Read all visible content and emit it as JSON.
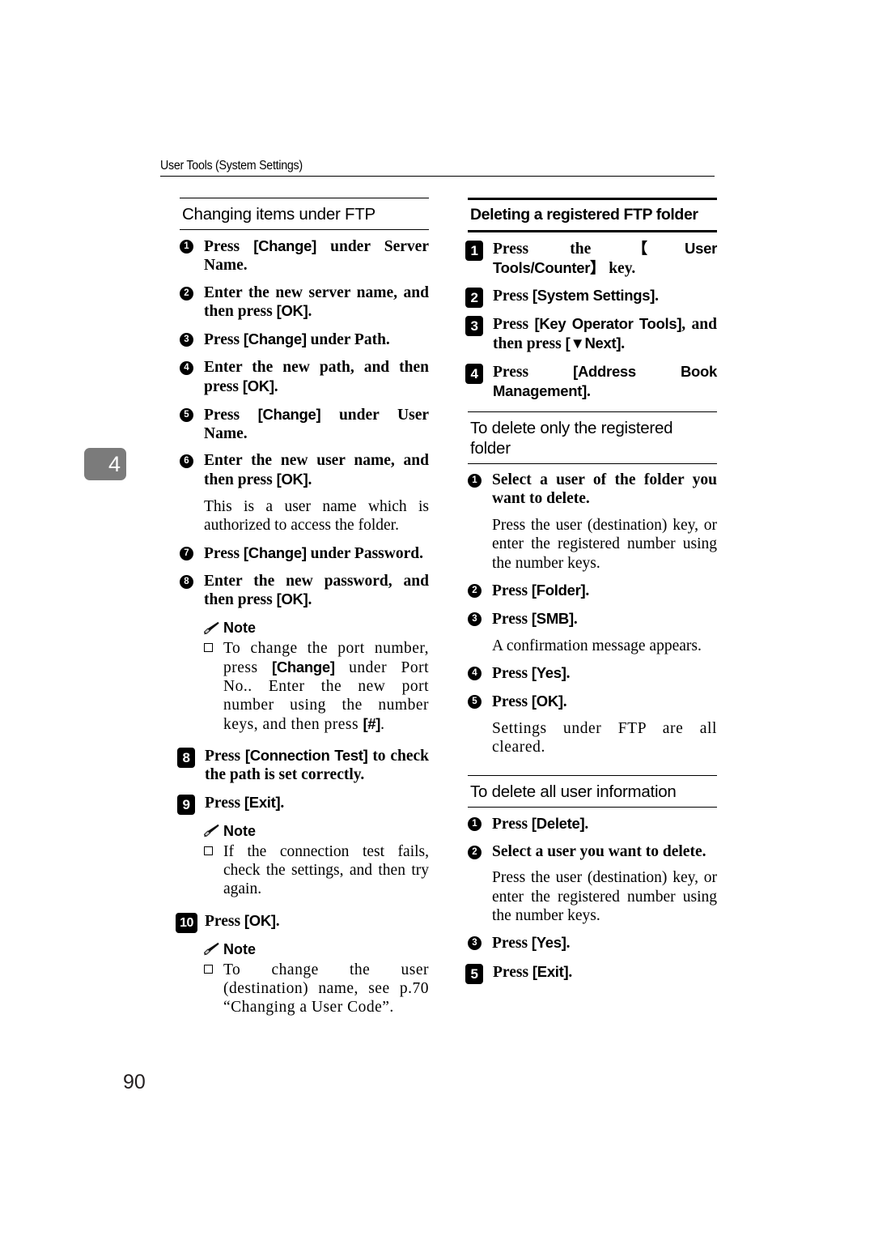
{
  "page": {
    "running_header": "User Tools (System Settings)",
    "chapter_tab": "4",
    "folio": "90"
  },
  "left_column": {
    "heading": "Changing items under FTP",
    "steps": [
      {
        "marker": "1",
        "type": "round",
        "text_parts": [
          {
            "t": "Press ",
            "style": "normal"
          },
          {
            "t": "[Change]",
            "style": "key"
          },
          {
            "t": " under Server Name.",
            "style": "normal"
          }
        ]
      },
      {
        "marker": "2",
        "type": "round",
        "text_parts": [
          {
            "t": "Enter the new server name, and then press ",
            "style": "normal"
          },
          {
            "t": "[OK]",
            "style": "key"
          },
          {
            "t": ".",
            "style": "normal"
          }
        ]
      },
      {
        "marker": "3",
        "type": "round",
        "text_parts": [
          {
            "t": "Press ",
            "style": "normal"
          },
          {
            "t": "[Change]",
            "style": "key"
          },
          {
            "t": " under Path.",
            "style": "normal"
          }
        ]
      },
      {
        "marker": "4",
        "type": "round",
        "text_parts": [
          {
            "t": "Enter the new path, and then press ",
            "style": "normal"
          },
          {
            "t": "[OK]",
            "style": "key"
          },
          {
            "t": ".",
            "style": "normal"
          }
        ]
      },
      {
        "marker": "5",
        "type": "round",
        "text_parts": [
          {
            "t": "Press ",
            "style": "normal"
          },
          {
            "t": "[Change]",
            "style": "key"
          },
          {
            "t": " under User Name.",
            "style": "normal"
          }
        ]
      },
      {
        "marker": "6",
        "type": "round",
        "text_parts": [
          {
            "t": "Enter the new user name, and then press ",
            "style": "normal"
          },
          {
            "t": "[OK]",
            "style": "key"
          },
          {
            "t": ".",
            "style": "normal"
          }
        ]
      }
    ],
    "body_after_6": "This is a user name which is authorized to access the folder.",
    "step7": {
      "marker": "7",
      "parts": [
        {
          "t": "Press ",
          "style": "normal"
        },
        {
          "t": "[Change]",
          "style": "key"
        },
        {
          "t": " under Password.",
          "style": "normal"
        }
      ]
    },
    "step8_sub": {
      "marker": "8",
      "parts": [
        {
          "t": "Enter the new password, and then press ",
          "style": "normal"
        },
        {
          "t": "[OK]",
          "style": "key"
        },
        {
          "t": ".",
          "style": "normal"
        }
      ]
    },
    "note1": {
      "title": "Note",
      "items": [
        [
          {
            "t": "To change the port number, press ",
            "style": "normal"
          },
          {
            "t": "[Change]",
            "style": "key"
          },
          {
            "t": " under Port No.. Enter the new port number using the number keys, and then press ",
            "style": "normal"
          },
          {
            "t": "[#]",
            "style": "key"
          },
          {
            "t": ".",
            "style": "normal"
          }
        ]
      ]
    },
    "step8_main": {
      "marker": "8",
      "parts": [
        {
          "t": "Press ",
          "style": "normal"
        },
        {
          "t": "[Connection Test]",
          "style": "key"
        },
        {
          "t": " to check the path is set correctly.",
          "style": "normal"
        }
      ]
    },
    "step9_main": {
      "marker": "9",
      "parts": [
        {
          "t": "Press ",
          "style": "normal"
        },
        {
          "t": "[Exit]",
          "style": "key"
        },
        {
          "t": ".",
          "style": "normal"
        }
      ]
    },
    "note2": {
      "title": "Note",
      "items": [
        [
          {
            "t": "If the connection test fails, check the settings, and then try again.",
            "style": "normal"
          }
        ]
      ]
    },
    "step10_main": {
      "marker": "10",
      "parts": [
        {
          "t": "Press ",
          "style": "normal"
        },
        {
          "t": "[OK]",
          "style": "key"
        },
        {
          "t": ".",
          "style": "normal"
        }
      ]
    },
    "note3": {
      "title": "Note",
      "items": [
        [
          {
            "t": "To change the user (destination) name, see p.70 “Changing a User Code”.",
            "style": "normal"
          }
        ]
      ]
    }
  },
  "right_column": {
    "heading": "Deleting a registered FTP folder",
    "steps": [
      {
        "marker": "1",
        "type": "square",
        "parts": [
          {
            "t": "Press the ",
            "style": "normal"
          },
          {
            "t": "【User Tools/Counter】",
            "style": "key"
          },
          {
            "t": " key.",
            "style": "normal"
          }
        ]
      },
      {
        "marker": "2",
        "type": "square",
        "parts": [
          {
            "t": "Press ",
            "style": "normal"
          },
          {
            "t": "[System Settings]",
            "style": "key"
          },
          {
            "t": ".",
            "style": "normal"
          }
        ]
      },
      {
        "marker": "3",
        "type": "square",
        "parts": [
          {
            "t": "Press ",
            "style": "normal"
          },
          {
            "t": "[Key Operator Tools]",
            "style": "key"
          },
          {
            "t": ", and then press ",
            "style": "normal"
          },
          {
            "t": "[▼Next]",
            "style": "key"
          },
          {
            "t": ".",
            "style": "normal"
          }
        ]
      },
      {
        "marker": "4",
        "type": "square",
        "parts": [
          {
            "t": "Press ",
            "style": "normal"
          },
          {
            "t": "[Address Book Management]",
            "style": "key"
          },
          {
            "t": ".",
            "style": "normal"
          }
        ]
      }
    ],
    "subheading_1": "To delete only the registered folder",
    "sub1_steps": [
      {
        "marker": "1",
        "parts": [
          {
            "t": "Select a user of the folder you want to delete.",
            "style": "normal"
          }
        ]
      }
    ],
    "sub1_body": "Press the user (destination) key, or enter the registered number using the number keys.",
    "sub1_steps_b": [
      {
        "marker": "2",
        "parts": [
          {
            "t": "Press ",
            "style": "normal"
          },
          {
            "t": "[Folder]",
            "style": "key"
          },
          {
            "t": ".",
            "style": "normal"
          }
        ]
      },
      {
        "marker": "3",
        "parts": [
          {
            "t": "Press ",
            "style": "normal"
          },
          {
            "t": "[SMB]",
            "style": "key"
          },
          {
            "t": ".",
            "style": "normal"
          }
        ]
      }
    ],
    "sub1_body_b": "A confirmation message appears.",
    "sub1_steps_c": [
      {
        "marker": "4",
        "parts": [
          {
            "t": "Press ",
            "style": "normal"
          },
          {
            "t": "[Yes]",
            "style": "key"
          },
          {
            "t": ".",
            "style": "normal"
          }
        ]
      },
      {
        "marker": "5",
        "parts": [
          {
            "t": "Press ",
            "style": "normal"
          },
          {
            "t": "[OK]",
            "style": "key"
          },
          {
            "t": ".",
            "style": "normal"
          }
        ]
      }
    ],
    "sub1_body_c": "Settings under FTP are all cleared.",
    "subheading_2": "To delete all user information",
    "sub2_steps": [
      {
        "marker": "1",
        "parts": [
          {
            "t": "Press ",
            "style": "normal"
          },
          {
            "t": "[Delete]",
            "style": "key"
          },
          {
            "t": ".",
            "style": "normal"
          }
        ]
      },
      {
        "marker": "2",
        "parts": [
          {
            "t": "Select a user you want to delete.",
            "style": "normal"
          }
        ]
      }
    ],
    "sub2_body": "Press the user (destination) key, or enter the registered number using the number keys.",
    "sub2_steps_b": [
      {
        "marker": "3",
        "parts": [
          {
            "t": "Press ",
            "style": "normal"
          },
          {
            "t": "[Yes]",
            "style": "key"
          },
          {
            "t": ".",
            "style": "normal"
          }
        ]
      }
    ],
    "step5_main": {
      "marker": "5",
      "parts": [
        {
          "t": "Press ",
          "style": "normal"
        },
        {
          "t": "[Exit]",
          "style": "key"
        },
        {
          "t": ".",
          "style": "normal"
        }
      ]
    }
  }
}
